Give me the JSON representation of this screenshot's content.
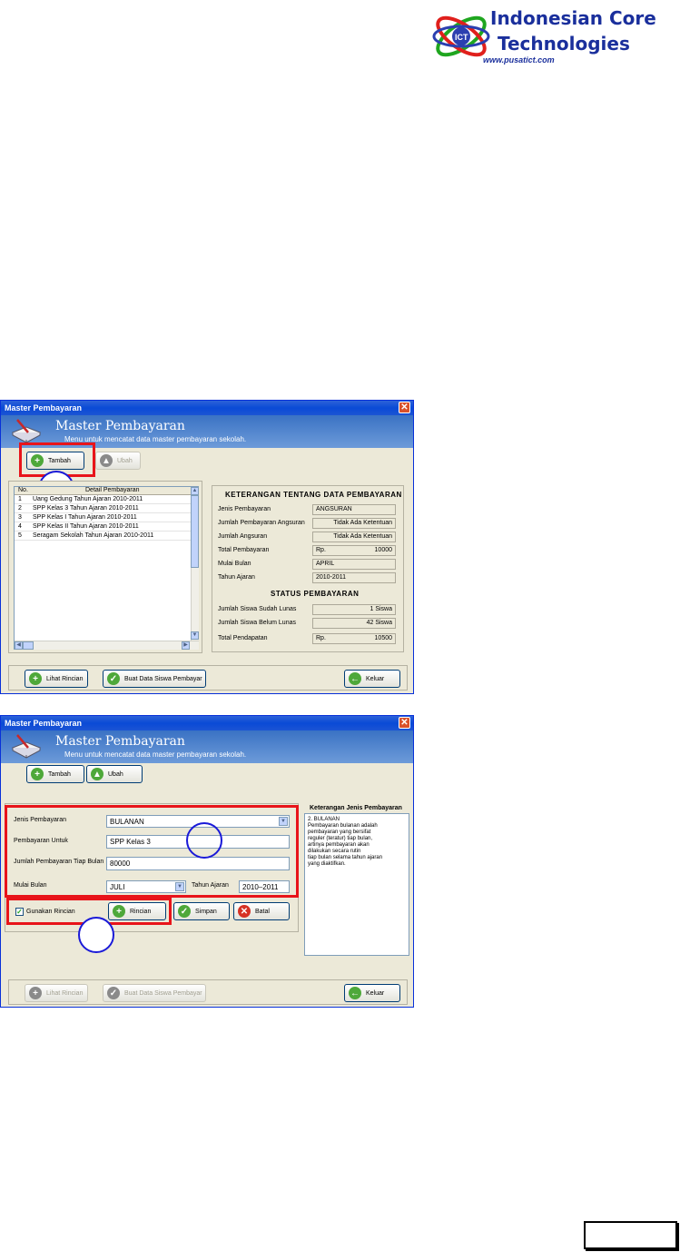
{
  "logo": {
    "line1": "Indonesian Core",
    "line2": "Technologies",
    "url": "www.pusatict.com"
  },
  "window1": {
    "title": "Master Pembayaran",
    "header_title": "Master Pembayaran",
    "header_subtitle": "Menu untuk mencatat data master pembayaran sekolah.",
    "toolbar": {
      "tambah": "Tambah",
      "ubah": "Ubah"
    },
    "grid": {
      "col_no": "No.",
      "col_detail": "Detail Pembayaran",
      "rows": [
        {
          "no": "1",
          "detail": "Uang Gedung Tahun Ajaran 2010-2011"
        },
        {
          "no": "2",
          "detail": "SPP Kelas 3 Tahun Ajaran 2010-2011"
        },
        {
          "no": "3",
          "detail": "SPP Kelas I Tahun Ajaran 2010-2011"
        },
        {
          "no": "4",
          "detail": "SPP Kelas II Tahun Ajaran 2010-2011"
        },
        {
          "no": "5",
          "detail": "Seragam Sekolah Tahun Ajaran 2010-2011"
        }
      ]
    },
    "info": {
      "title": "KETERANGAN TENTANG DATA PEMBAYARAN",
      "jenis_label": "Jenis Pembayaran",
      "jenis_value": "ANGSURAN",
      "jml_angsuran_label": "Jumlah Pembayaran Angsuran",
      "jml_angsuran_value": "Tidak Ada Ketentuan",
      "angsuran_label": "Jumlah Angsuran",
      "angsuran_value": "Tidak Ada Ketentuan",
      "total_label": "Total Pembayaran",
      "total_cur": "Rp.",
      "total_value": "10000",
      "mulai_label": "Mulai Bulan",
      "mulai_value": "APRIL",
      "tahun_label": "Tahun Ajaran",
      "tahun_value": "2010-2011",
      "status_title": "STATUS PEMBAYARAN",
      "lunas_label": "Jumlah Siswa Sudah Lunas",
      "lunas_value": "1 Siswa",
      "belum_label": "Jumlah Siswa Belum Lunas",
      "belum_value": "42 Siswa",
      "pendapatan_label": "Total Pendapatan",
      "pendapatan_cur": "Rp.",
      "pendapatan_value": "10500"
    },
    "footer": {
      "lihat": "Lihat Rincian",
      "buat": "Buat Data Siswa Pembayar",
      "keluar": "Keluar"
    }
  },
  "window2": {
    "title": "Master Pembayaran",
    "header_title": "Master Pembayaran",
    "header_subtitle": "Menu untuk mencatat data master pembayaran sekolah.",
    "toolbar": {
      "tambah": "Tambah",
      "ubah": "Ubah"
    },
    "form": {
      "jenis_label": "Jenis Pembayaran",
      "jenis_value": "BULANAN",
      "untuk_label": "Pembayaran Untuk",
      "untuk_value": "SPP Kelas 3",
      "jumlah_label": "Jumlah Pembayaran Tiap Bulan",
      "jumlah_value": "80000",
      "mulai_label": "Mulai Bulan",
      "mulai_value": "JULI",
      "tahun_label": "Tahun Ajaran",
      "tahun_value": "2010–2011",
      "gunakan_label": "Gunakan Rincian",
      "rincian": "Rincian",
      "simpan": "Simpan",
      "batal": "Batal"
    },
    "desc": {
      "title": "Keterangan Jenis Pembayaran",
      "text": "2. BULANAN\n    Pembayaran bulanan adalah\n    pembayaran yang bersifat\n    reguler (teratur) tiap bulan,\n    artinya pembayaran akan\n    dilakukan secara rutin\n    tiap bulan selama tahun ajaran\n    yang diaktifkan."
    },
    "footer": {
      "lihat": "Lihat Rincian",
      "buat": "Buat Data Siswa Pembayar",
      "keluar": "Keluar"
    }
  },
  "colors": {
    "red_highlight": "#e8141a",
    "circle_blue": "#1a1ad8",
    "logo_blue": "#1a2f9c"
  }
}
